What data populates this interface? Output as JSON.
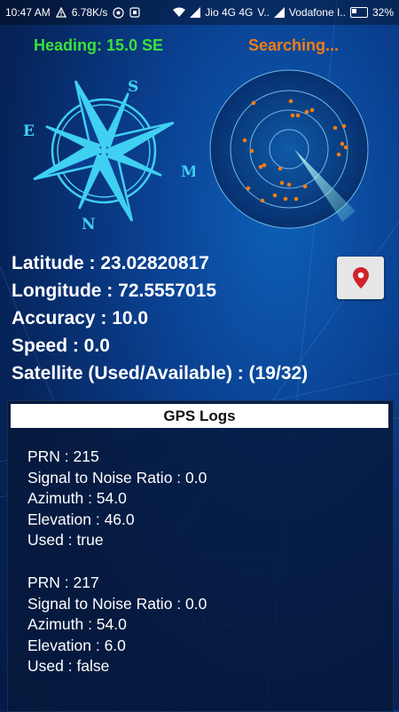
{
  "status_bar": {
    "time": "10:47 AM",
    "speed": "6.78K/s",
    "carrier1": "Jio 4G 4G",
    "carrier1_suffix": "V..",
    "carrier2": "Vodafone I..",
    "battery": "32%"
  },
  "header": {
    "heading": "Heading: 15.0 SE",
    "status": "Searching..."
  },
  "compass": {
    "labels": [
      "S",
      "M",
      "N",
      "E"
    ]
  },
  "radar": {
    "sweep_color": "#7ee6e6",
    "dot_color": "#f07d17"
  },
  "info": {
    "latitude": "Latitude : 23.02820817",
    "longitude": "Longitude : 72.5557015",
    "accuracy": "Accuracy : 10.0",
    "speed": "Speed : 0.0",
    "satellite": "Satellite (Used/Available) : (19/32)"
  },
  "map_button": {
    "icon": "map-pin-icon",
    "color": "#d0232a"
  },
  "logs": {
    "title": "GPS Logs",
    "entries": [
      {
        "prn": "PRN : 215",
        "snr": "Signal to Noise Ratio : 0.0",
        "azimuth": "Azimuth : 54.0",
        "elevation": "Elevation : 46.0",
        "used": "Used : true"
      },
      {
        "prn": "PRN : 217",
        "snr": "Signal to Noise Ratio : 0.0",
        "azimuth": "Azimuth : 54.0",
        "elevation": "Elevation : 6.0",
        "used": "Used : false"
      }
    ]
  },
  "colors": {
    "heading": "#39e13a",
    "searching": "#f07d17",
    "compass": "#3fd0f2"
  }
}
